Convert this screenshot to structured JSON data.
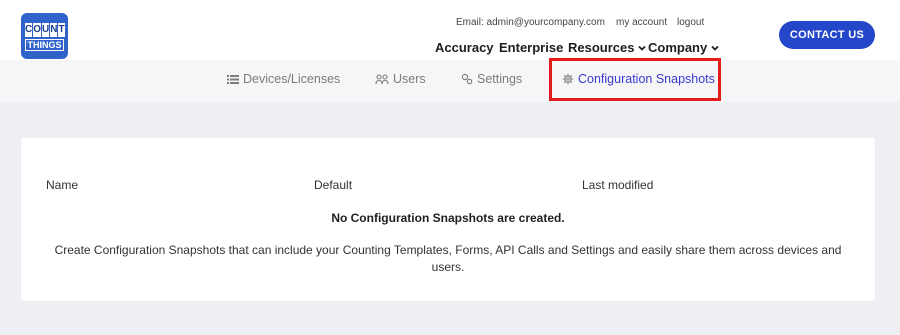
{
  "logo": {
    "top_letters": [
      "C",
      "O",
      "U",
      "N",
      "T"
    ],
    "bottom_text": "THINGS"
  },
  "header": {
    "email": "Email: admin@yourcompany.com",
    "my_account": "my account",
    "logout": "logout",
    "nav": {
      "accuracy": "Accuracy",
      "enterprise": "Enterprise",
      "resources": "Resources",
      "company": "Company"
    },
    "contact_button": "CONTACT US"
  },
  "tabs": {
    "devices": "Devices/Licenses",
    "users": "Users",
    "settings": "Settings",
    "config": "Configuration Snapshots",
    "active": "config"
  },
  "table": {
    "columns": [
      "Name",
      "Default",
      "Last modified"
    ],
    "empty_title": "No Configuration Snapshots are created.",
    "empty_description": "Create Configuration Snapshots that can include your Counting Templates, Forms, API Calls and Settings and easily share them across devices and users."
  },
  "colors": {
    "brand_blue": "#2446c8",
    "active_tab": "#3a3ad0",
    "highlight": "#e21b1b",
    "page_bg": "#eeeff3"
  },
  "icons": [
    "list-icon",
    "users-icon",
    "settings-icon",
    "gear-icon",
    "chevron-down-icon"
  ]
}
